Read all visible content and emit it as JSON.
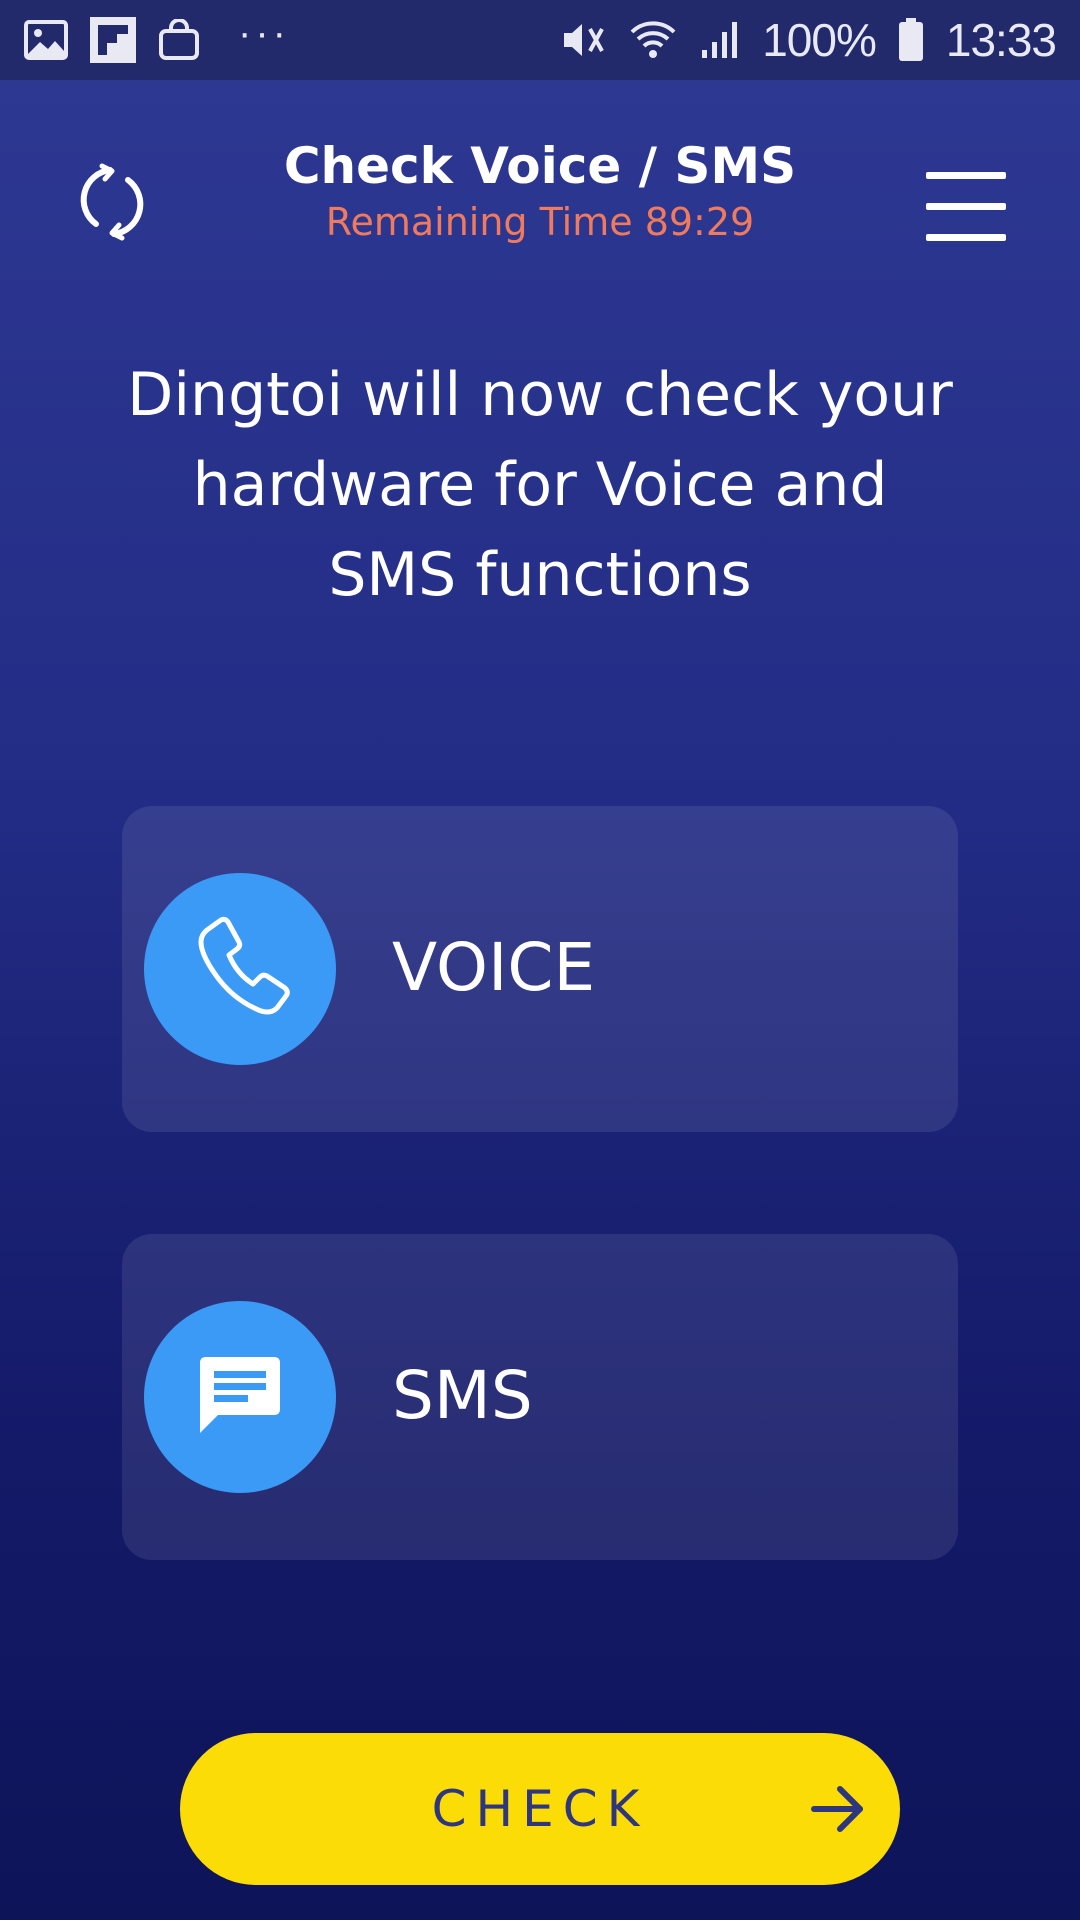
{
  "status_bar": {
    "left_icons": [
      "gallery-icon",
      "flipboard-icon",
      "shopping-bag-icon"
    ],
    "more_indicator": "···",
    "right_icons": [
      "vibrate-mute-icon",
      "wifi-icon",
      "signal-icon",
      "battery-icon"
    ],
    "battery": "100%",
    "time": "13:33"
  },
  "header": {
    "title": "Check Voice / SMS",
    "remaining_time": "Remaining Time 89:29",
    "remaining_time_color": "#f07a5d",
    "left_icon": "refresh-icon",
    "right_icon": "hamburger-menu-icon"
  },
  "description": "Dingtoi will now check your hardware for Voice and SMS functions",
  "options": [
    {
      "label": "VOICE",
      "icon": "phone-icon"
    },
    {
      "label": "SMS",
      "icon": "message-icon"
    }
  ],
  "check_button": {
    "label": "CHECK",
    "icon": "arrow-right-icon",
    "color": "#fcdc07"
  },
  "colors": {
    "background_top": "#2e3993",
    "background_bottom": "#0e1458",
    "accent_blue": "#3a9af5",
    "button_text": "#2d367e"
  }
}
